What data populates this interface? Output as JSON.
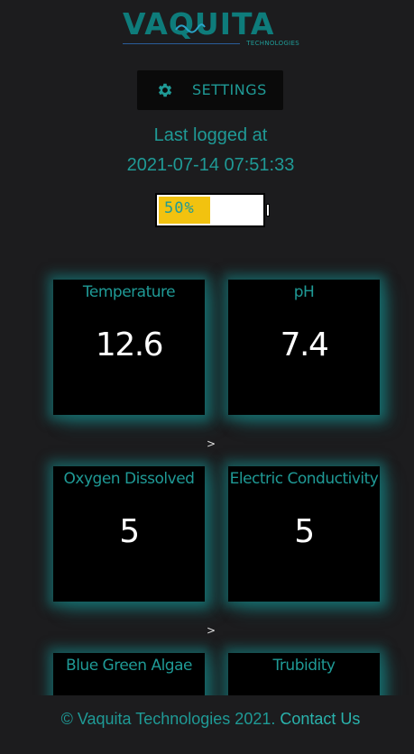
{
  "brand": {
    "name": "VAQUITA",
    "tagline": "TECHNOLOGIES"
  },
  "settings": {
    "label": "SETTINGS",
    "icon": "gear-icon"
  },
  "log": {
    "title": "Last logged at",
    "timestamp": "2021-07-14 07:51:33"
  },
  "battery": {
    "label": "50%",
    "level_percent": 50
  },
  "sensors": [
    {
      "label": "Temperature",
      "value": "12.6"
    },
    {
      "label": "pH",
      "value": "7.4"
    },
    {
      "label": "Oxygen Dissolved",
      "value": "5"
    },
    {
      "label": "Electric Conductivity",
      "value": "5"
    },
    {
      "label": "Blue Green Algae",
      "value": ""
    },
    {
      "label": "Trubidity",
      "value": ""
    }
  ],
  "row_separator": ">",
  "footer": {
    "copyright": "© Vaquita Technologies 2021.",
    "contact_label": "Contact Us"
  },
  "colors": {
    "background": "#1c1c1e",
    "accent": "#1f9a96",
    "brand": "#0e7c7b",
    "battery_fill": "#f2c20f",
    "card_bg": "#000000",
    "value_text": "#ffffff"
  }
}
